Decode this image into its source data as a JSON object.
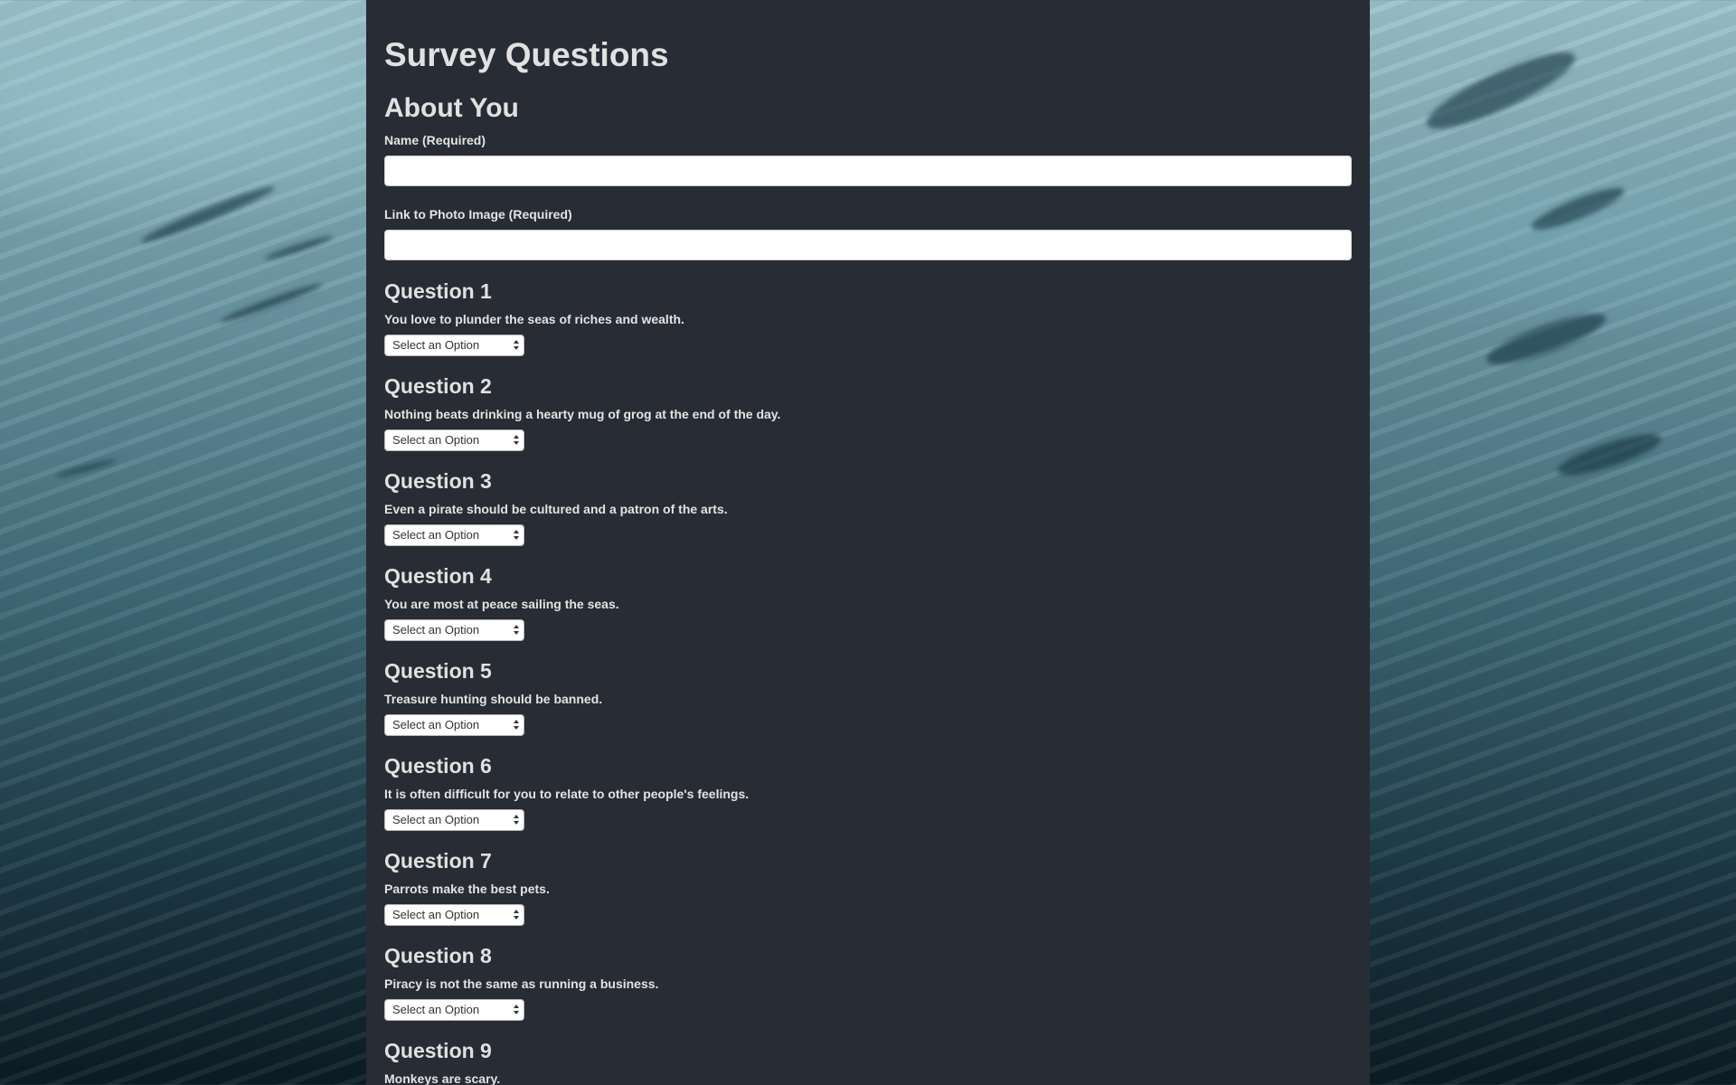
{
  "page": {
    "title": "Survey Questions",
    "section_title": "About You"
  },
  "about": {
    "name_label": "Name (Required)",
    "name_value": "",
    "photo_label": "Link to Photo Image (Required)",
    "photo_value": ""
  },
  "questions": [
    {
      "heading": "Question 1",
      "text": "You love to plunder the seas of riches and wealth.",
      "selected": "Select an Option"
    },
    {
      "heading": "Question 2",
      "text": "Nothing beats drinking a hearty mug of grog at the end of the day.",
      "selected": "Select an Option"
    },
    {
      "heading": "Question 3",
      "text": "Even a pirate should be cultured and a patron of the arts.",
      "selected": "Select an Option"
    },
    {
      "heading": "Question 4",
      "text": "You are most at peace sailing the seas.",
      "selected": "Select an Option"
    },
    {
      "heading": "Question 5",
      "text": "Treasure hunting should be banned.",
      "selected": "Select an Option"
    },
    {
      "heading": "Question 6",
      "text": "It is often difficult for you to relate to other people's feelings.",
      "selected": "Select an Option"
    },
    {
      "heading": "Question 7",
      "text": "Parrots make the best pets.",
      "selected": "Select an Option"
    },
    {
      "heading": "Question 8",
      "text": "Piracy is not the same as running a business.",
      "selected": "Select an Option"
    },
    {
      "heading": "Question 9",
      "text": "Monkeys are scary.",
      "selected": ""
    }
  ],
  "colors": {
    "panel_bg": "#282c34",
    "text": "#e1e1e1",
    "input_bg": "#ffffff"
  }
}
